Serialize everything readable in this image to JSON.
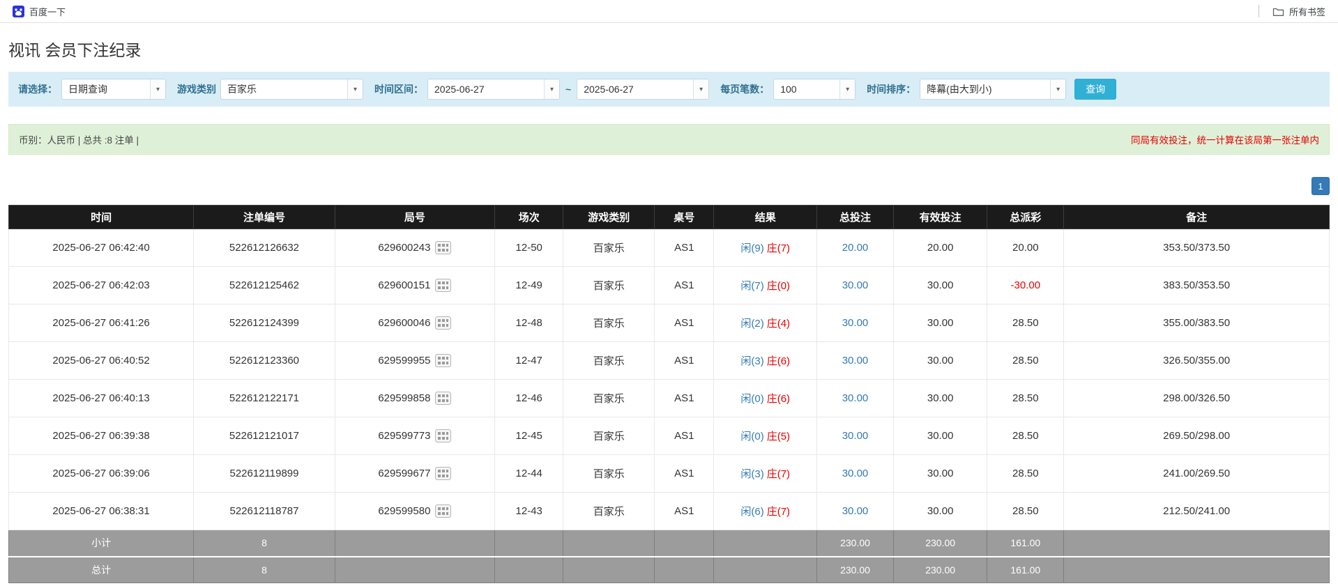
{
  "colors": {
    "accent": "#31b0d5",
    "page-btn": "#337ab7",
    "link": "#337ab7",
    "player": "#337ab7",
    "banker": "#e60000",
    "negative": "#e60000",
    "filter-bg": "#d9edf7",
    "summary-bg": "#dff0d8",
    "header-bg": "#1b1b1b",
    "footer-bg": "#9c9c9c"
  },
  "bookmarks_bar": {
    "bookmark_label": "百度一下",
    "all_bookmarks_label": "所有书签"
  },
  "page": {
    "title": "视讯 会员下注纪录"
  },
  "filters": {
    "select_label": "请选择：",
    "select_value": "日期查询",
    "game_type_label": "游戏类别",
    "game_type_value": "百家乐",
    "time_range_label": "时间区间：",
    "date_from": "2025-06-27",
    "tilde": "~",
    "date_to": "2025-06-27",
    "page_size_label": "每页笔数：",
    "page_size_value": "100",
    "sort_label": "时间排序：",
    "sort_value": "降幕(由大到小)",
    "query_button": "查询"
  },
  "summary": {
    "left": "币别：人民币 | 总共 :8 注单 |",
    "right": "同局有效投注，统一计算在该局第一张注单内"
  },
  "pagination": {
    "current": "1"
  },
  "table": {
    "headers": [
      "时间",
      "注单编号",
      "局号",
      "场次",
      "游戏类别",
      "桌号",
      "结果",
      "总投注",
      "有效投注",
      "总派彩",
      "备注"
    ],
    "rows": [
      {
        "time": "2025-06-27 06:42:40",
        "bet_no": "522612126632",
        "round_no": "629600243",
        "session": "12-50",
        "game": "百家乐",
        "table_no": "AS1",
        "result_player": "闲(9)",
        "result_banker": "庄(7)",
        "total_bet": "20.00",
        "valid_bet": "20.00",
        "payout": "20.00",
        "payout_neg": false,
        "remark": "353.50/373.50"
      },
      {
        "time": "2025-06-27 06:42:03",
        "bet_no": "522612125462",
        "round_no": "629600151",
        "session": "12-49",
        "game": "百家乐",
        "table_no": "AS1",
        "result_player": "闲(7)",
        "result_banker": "庄(0)",
        "total_bet": "30.00",
        "valid_bet": "30.00",
        "payout": "-30.00",
        "payout_neg": true,
        "remark": "383.50/353.50"
      },
      {
        "time": "2025-06-27 06:41:26",
        "bet_no": "522612124399",
        "round_no": "629600046",
        "session": "12-48",
        "game": "百家乐",
        "table_no": "AS1",
        "result_player": "闲(2)",
        "result_banker": "庄(4)",
        "total_bet": "30.00",
        "valid_bet": "30.00",
        "payout": "28.50",
        "payout_neg": false,
        "remark": "355.00/383.50"
      },
      {
        "time": "2025-06-27 06:40:52",
        "bet_no": "522612123360",
        "round_no": "629599955",
        "session": "12-47",
        "game": "百家乐",
        "table_no": "AS1",
        "result_player": "闲(3)",
        "result_banker": "庄(6)",
        "total_bet": "30.00",
        "valid_bet": "30.00",
        "payout": "28.50",
        "payout_neg": false,
        "remark": "326.50/355.00"
      },
      {
        "time": "2025-06-27 06:40:13",
        "bet_no": "522612122171",
        "round_no": "629599858",
        "session": "12-46",
        "game": "百家乐",
        "table_no": "AS1",
        "result_player": "闲(0)",
        "result_banker": "庄(6)",
        "total_bet": "30.00",
        "valid_bet": "30.00",
        "payout": "28.50",
        "payout_neg": false,
        "remark": "298.00/326.50"
      },
      {
        "time": "2025-06-27 06:39:38",
        "bet_no": "522612121017",
        "round_no": "629599773",
        "session": "12-45",
        "game": "百家乐",
        "table_no": "AS1",
        "result_player": "闲(0)",
        "result_banker": "庄(5)",
        "total_bet": "30.00",
        "valid_bet": "30.00",
        "payout": "28.50",
        "payout_neg": false,
        "remark": "269.50/298.00"
      },
      {
        "time": "2025-06-27 06:39:06",
        "bet_no": "522612119899",
        "round_no": "629599677",
        "session": "12-44",
        "game": "百家乐",
        "table_no": "AS1",
        "result_player": "闲(3)",
        "result_banker": "庄(7)",
        "total_bet": "30.00",
        "valid_bet": "30.00",
        "payout": "28.50",
        "payout_neg": false,
        "remark": "241.00/269.50"
      },
      {
        "time": "2025-06-27 06:38:31",
        "bet_no": "522612118787",
        "round_no": "629599580",
        "session": "12-43",
        "game": "百家乐",
        "table_no": "AS1",
        "result_player": "闲(6)",
        "result_banker": "庄(7)",
        "total_bet": "30.00",
        "valid_bet": "30.00",
        "payout": "28.50",
        "payout_neg": false,
        "remark": "212.50/241.00"
      }
    ],
    "footer_rows": [
      {
        "label": "小计",
        "count": "8",
        "total_bet": "230.00",
        "valid_bet": "230.00",
        "payout": "161.00"
      },
      {
        "label": "总计",
        "count": "8",
        "total_bet": "230.00",
        "valid_bet": "230.00",
        "payout": "161.00"
      }
    ]
  }
}
